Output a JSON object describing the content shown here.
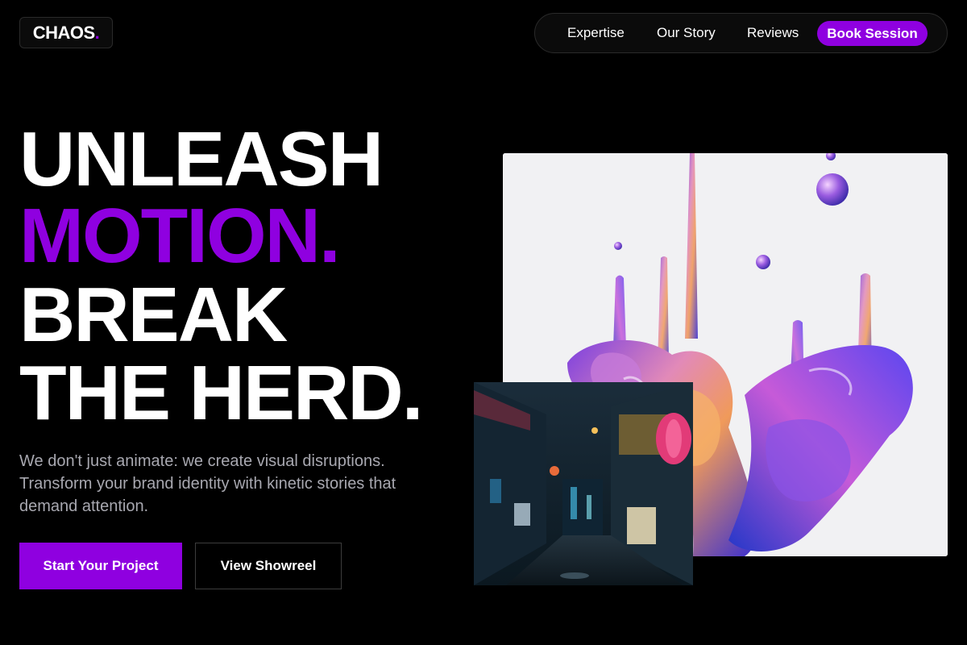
{
  "brand": {
    "name": "CHAOS",
    "dot": ".",
    "accent": "#8f00e0"
  },
  "nav": {
    "links": [
      "Expertise",
      "Our Story",
      "Reviews"
    ],
    "cta": "Book Session"
  },
  "hero": {
    "line1": "UNLEASH",
    "line2": "MOTION.",
    "line3": "BREAK",
    "line4": "THE HERD.",
    "subtitle": "We don't just animate: we create visual disruptions. Transform your brand identity with kinetic stories that demand attention.",
    "primary_button": "Start Your Project",
    "secondary_button": "View Showreel"
  },
  "images": {
    "liquid": "iridescent liquid splash artwork",
    "alley": "neon night alley photograph"
  },
  "colors": {
    "background": "#000000",
    "accent": "#8f00e0",
    "text": "#ffffff",
    "muted": "#a8a8b0"
  }
}
